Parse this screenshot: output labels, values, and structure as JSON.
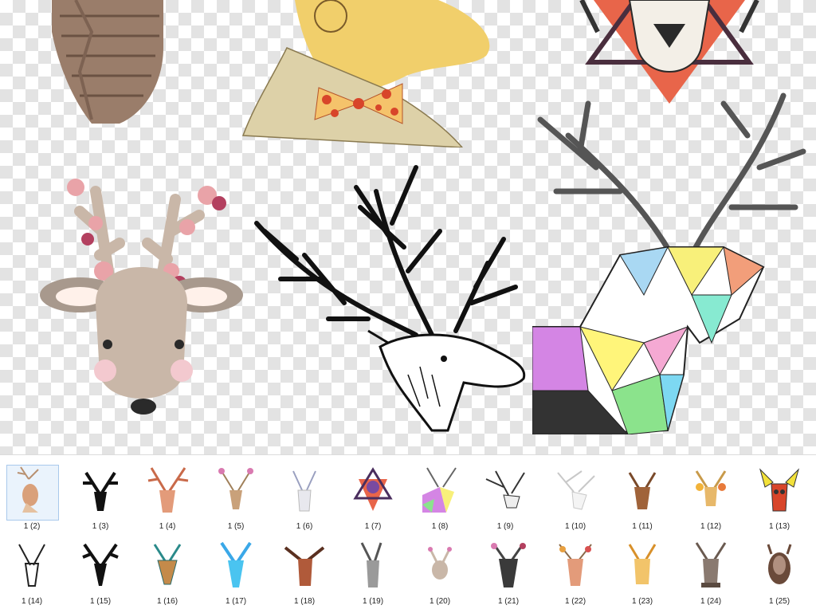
{
  "thumbnails": [
    {
      "label": "1 (2)",
      "icon": "deer-illustration-icon"
    },
    {
      "label": "1 (3)",
      "icon": "black-deer-head-icon"
    },
    {
      "label": "1 (4)",
      "icon": "watercolor-deer-icon"
    },
    {
      "label": "1 (5)",
      "icon": "floral-deer-icon"
    },
    {
      "label": "1 (6)",
      "icon": "white-deer-icon"
    },
    {
      "label": "1 (7)",
      "icon": "ethnic-deer-icon"
    },
    {
      "label": "1 (8)",
      "icon": "geometric-deer-icon"
    },
    {
      "label": "1 (9)",
      "icon": "sketch-deer-icon"
    },
    {
      "label": "1 (10)",
      "icon": "lineart-deer-icon"
    },
    {
      "label": "1 (11)",
      "icon": "brown-deer-icon"
    },
    {
      "label": "1 (12)",
      "icon": "flower-deer-icon"
    },
    {
      "label": "1 (13)",
      "icon": "moose-icon"
    },
    {
      "label": "1 (14)",
      "icon": "ink-deer-icon"
    },
    {
      "label": "1 (15)",
      "icon": "silhouette-deer-icon"
    },
    {
      "label": "1 (16)",
      "icon": "teal-deer-icon"
    },
    {
      "label": "1 (17)",
      "icon": "blue-deer-icon"
    },
    {
      "label": "1 (18)",
      "icon": "red-deer-icon"
    },
    {
      "label": "1 (19)",
      "icon": "gray-deer-icon"
    },
    {
      "label": "1 (20)",
      "icon": "cute-deer-icon"
    },
    {
      "label": "1 (21)",
      "icon": "dark-deer-icon"
    },
    {
      "label": "1 (22)",
      "icon": "floral-antler-deer-icon"
    },
    {
      "label": "1 (23)",
      "icon": "yellow-deer-icon"
    },
    {
      "label": "1 (24)",
      "icon": "mounted-deer-icon"
    },
    {
      "label": "1 (25)",
      "icon": "trophy-deer-icon"
    }
  ],
  "selected_thumbnail": "1 (2)",
  "colors": {
    "checker": "#e3e3e3",
    "selection_border": "#a9c9ec",
    "selection_fill": "#eaf3fc"
  }
}
